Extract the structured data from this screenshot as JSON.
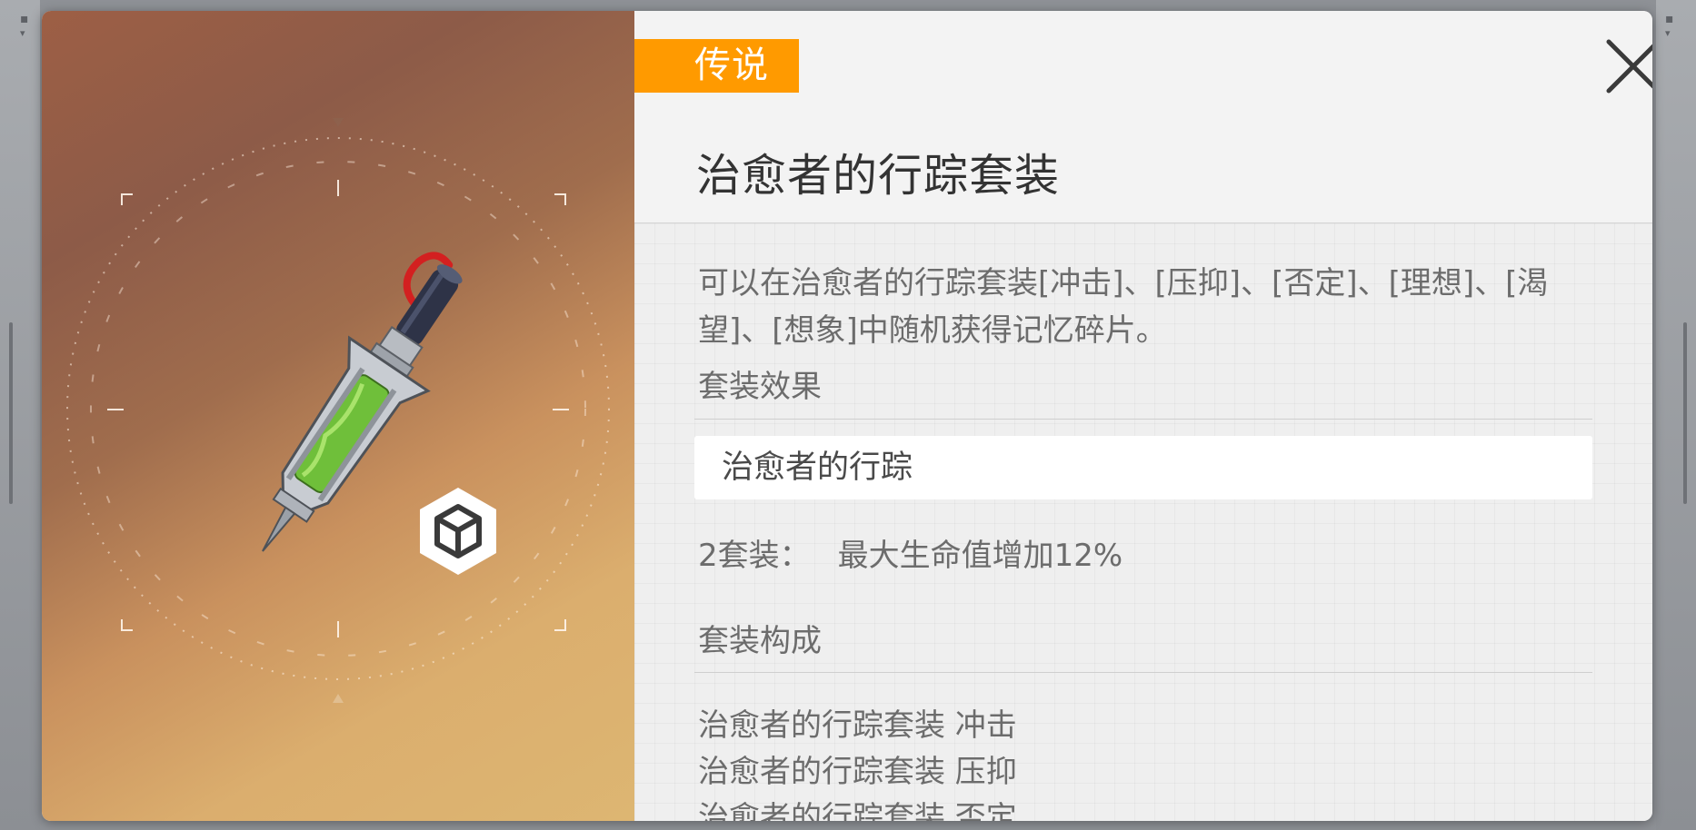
{
  "item": {
    "rarity": "传说",
    "title": "治愈者的行踪套装",
    "description": "可以在治愈者的行踪套装[冲击]、[压抑]、[否定]、[理想]、[渴望]、[想象]中随机获得记忆碎片。"
  },
  "set_effect": {
    "heading": "套装效果",
    "set_name": "治愈者的行踪",
    "bonus_label": "2套装：",
    "bonus_text": "最大生命值增加12%"
  },
  "set_composition": {
    "heading": "套装构成",
    "pieces": [
      "治愈者的行踪套装 冲击",
      "治愈者的行踪套装 压抑",
      "治愈者的行踪套装 否定"
    ]
  },
  "icons": {
    "close": "close-icon",
    "item": "syringe-item-icon",
    "badge": "cube-badge-icon",
    "dial": "targeting-dial-icon"
  },
  "colors": {
    "rarity_badge": "#ff9a00",
    "title_text": "#333333",
    "body_text": "#6c6c6c",
    "liquid": "#6fbf3a",
    "strap": "#d32020"
  }
}
